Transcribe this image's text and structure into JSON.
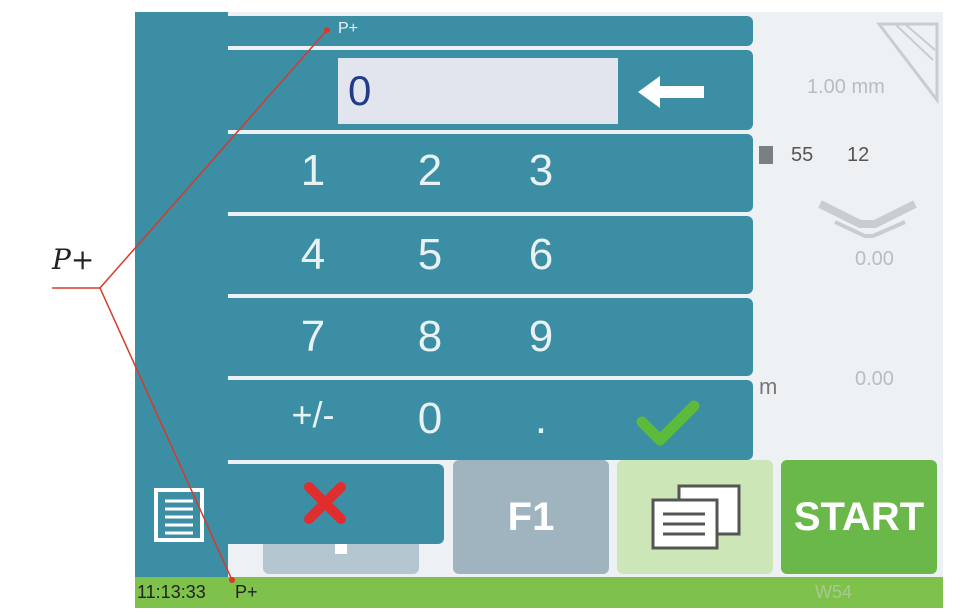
{
  "annotation_label": "P+",
  "status": {
    "time": "11:13:33",
    "mode": "P+",
    "right": "W54"
  },
  "numpad": {
    "header": "P+",
    "value": "0",
    "rows": [
      [
        "1",
        "2",
        "3"
      ],
      [
        "4",
        "5",
        "6"
      ],
      [
        "7",
        "8",
        "9"
      ],
      [
        "+/-",
        "0",
        "."
      ]
    ]
  },
  "background": {
    "thickness": "1.00 mm",
    "tool_a": "55",
    "tool_b": "12",
    "value_1": "0.00",
    "value_2": "0.00",
    "unit_partial": "m"
  },
  "buttons": {
    "f1": "F1",
    "start": "START"
  },
  "colors": {
    "panel": "#3c8ea5",
    "status": "#7ec24c",
    "start": "#6ab84a",
    "confirm": "#5dba3c",
    "cancel": "#e02d2d"
  },
  "icons": [
    "backspace-arrow-icon",
    "confirm-check-icon",
    "cancel-x-icon",
    "program-list-icon",
    "copy-documents-icon",
    "machine-graphic-icon",
    "die-graphic-icon"
  ]
}
